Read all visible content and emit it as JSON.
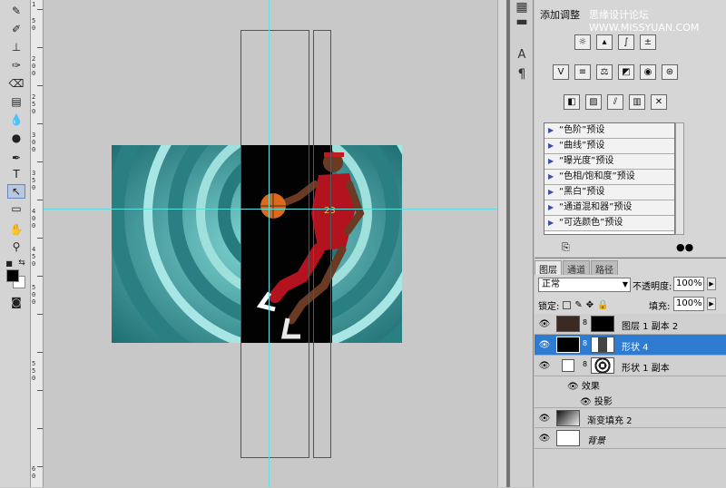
{
  "toolbox": {
    "tools": [
      "healing-brush",
      "brush",
      "clone-stamp",
      "history-brush",
      "eraser",
      "gradient",
      "blur",
      "dodge",
      "pen",
      "type",
      "path-selection",
      "rectangle",
      "hand",
      "zoom"
    ],
    "active_tool": "path-selection"
  },
  "ruler": {
    "labels": [
      "1",
      "5",
      "0",
      "2",
      "0",
      "0",
      "2",
      "5",
      "0",
      "3",
      "0",
      "0",
      "3",
      "5",
      "0",
      "4",
      "0",
      "0",
      "4",
      "5",
      "0",
      "5",
      "0",
      "0",
      "5",
      "5",
      "0",
      "6",
      "0"
    ]
  },
  "adjustments": {
    "title": "添加调整",
    "watermark": "思缘设计论坛 WWW.MISSYUAN.COM",
    "presets": [
      "“色阶”预设",
      "“曲线”预设",
      "“曝光度”预设",
      "“色相/饱和度”预设",
      "“黑白”预设",
      "“通道混和器”预设",
      "“可选颜色”预设"
    ]
  },
  "layers": {
    "tabs": [
      "图层",
      "通道",
      "路径"
    ],
    "active_tab": "图层",
    "blend_mode": "正常",
    "opacity_label": "不透明度:",
    "opacity_value": "100%",
    "lock_label": "锁定:",
    "fill_label": "填充:",
    "fill_value": "100%",
    "items": [
      {
        "name": "图层 1 副本 2",
        "selected": false
      },
      {
        "name": "形状 4",
        "selected": true
      },
      {
        "name": "形状 1 副本",
        "selected": false
      },
      {
        "name": "渐变填充 2",
        "selected": false
      },
      {
        "name": "背景",
        "selected": false
      }
    ],
    "effects_label": "效果",
    "drop_shadow_label": "投影"
  },
  "colors": {
    "guide": "#5fe0e0",
    "selected_row": "#2e7cd2",
    "teal": "#3c9a9d"
  }
}
